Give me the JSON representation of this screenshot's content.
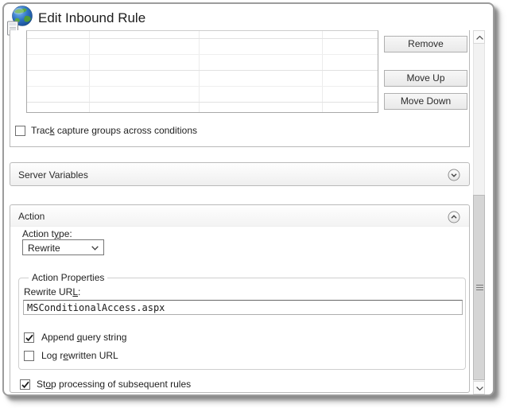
{
  "title": "Edit Inbound Rule",
  "conditions": {
    "grid": {
      "columns": 4,
      "rows": 5,
      "empty": true
    },
    "remove_button": "Remove",
    "move_up_button": "Move Up",
    "move_down_button": "Move Down",
    "track_capture": {
      "pre": "Trac",
      "accel": "k",
      "post": " capture groups across conditions",
      "checked": false
    }
  },
  "server_variables": {
    "title": "Server Variables",
    "collapsed": true
  },
  "action": {
    "header": "Action",
    "collapsed": false,
    "type_label": {
      "pre": "Action t",
      "accel": "y",
      "post": "pe:"
    },
    "type_value": "Rewrite",
    "properties": {
      "legend": "Action Properties",
      "url_label": {
        "pre": "Rewrite UR",
        "accel": "L",
        "post": ":"
      },
      "url_value": "MSConditionalAccess.aspx",
      "append_query": {
        "pre": "Append ",
        "accel": "q",
        "post": "uery string",
        "checked": true
      },
      "log_rewritten": {
        "pre": "Log r",
        "accel": "e",
        "post": "written URL",
        "checked": false
      }
    },
    "stop_processing": {
      "pre": "St",
      "accel": "o",
      "post": "p processing of subsequent rules",
      "checked": true
    }
  },
  "colors": {
    "window_border": "#9c9c9c",
    "section_border": "#bababa",
    "text": "#1f1f1f"
  }
}
